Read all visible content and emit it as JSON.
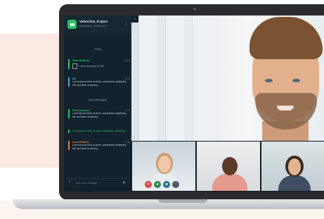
{
  "app": {
    "title": "VideoChat_Project",
    "subtitle": "participants · active now"
  },
  "chat": {
    "menu_icon": "ellipsis-icon",
    "today_label": "Today",
    "new_messages_label": "New Messages",
    "messages": [
      {
        "name": "Sara Miranda",
        "name_color": "#2bbf6a",
        "time": "10:24",
        "text": "",
        "file": "Lorem ipsum.jpg  2.4 MB"
      },
      {
        "name": "Me",
        "name_color": "#4fa3e0",
        "time": "10:26",
        "text": "Lorem ipsum dolor sit amet, consectetur adipiscing elit, sed diam nonummy.",
        "file": ""
      },
      {
        "name": "Paul Johnson",
        "name_color": "#2bbf6a",
        "time": "10:31",
        "text": "Lorem ipsum dolor sit amet, consectetur adipiscing elit, sed diam nonummy.",
        "file": ""
      },
      {
        "name": "",
        "name_color": "#2bbf6a",
        "time": "",
        "text": "Lorem ipsum dolor sit amet consectetur adipiscing.",
        "file": ""
      },
      {
        "name": "Laura Palmer",
        "name_color": "#e0843a",
        "time": "10:34",
        "text": "Lorem ipsum dolor sit amet, consectetur adipiscing elit, sed diam nonummy.",
        "file": ""
      }
    ],
    "input_placeholder": "Type your message",
    "attach_icon": "plus-icon",
    "send_icon": "send-icon"
  },
  "call_controls": {
    "end_icon": "phone-end-icon",
    "mic_icon": "microphone-icon",
    "camera_icon": "camera-icon",
    "more_icon": "more-icon"
  },
  "colors": {
    "accent": "#2bbf6a",
    "end_call": "#e0453a",
    "panel_bg": "#13222c"
  }
}
